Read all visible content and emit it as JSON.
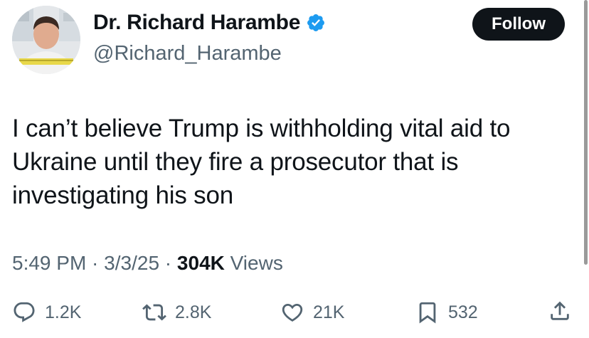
{
  "author": {
    "display_name": "Dr. Richard Harambe",
    "handle": "@Richard_Harambe",
    "verified": true,
    "verified_color": "#1d9bf0"
  },
  "follow_button": {
    "label": "Follow",
    "background": "#0f1419",
    "text_color": "#ffffff"
  },
  "tweet": {
    "lines": [
      "I can’t believe Trump is withholding vital aid to",
      "Ukraine until they fire a prosecutor that is",
      "investigating his son"
    ]
  },
  "meta": {
    "time": "5:49 PM",
    "sep1": " · ",
    "date": "3/3/25",
    "sep2": " · ",
    "views_count": "304K",
    "views_label": " Views"
  },
  "actions": {
    "replies": {
      "icon": "reply-icon",
      "count": "1.2K"
    },
    "reposts": {
      "icon": "repost-icon",
      "count": "2.8K"
    },
    "likes": {
      "icon": "like-icon",
      "count": "21K"
    },
    "bookmarks": {
      "icon": "bookmark-icon",
      "count": "532"
    },
    "share": {
      "icon": "share-icon"
    }
  }
}
